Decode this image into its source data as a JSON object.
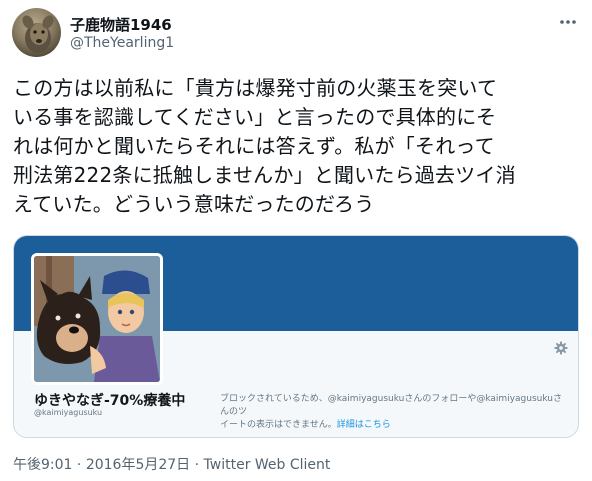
{
  "author": {
    "display_name": "子鹿物語1946",
    "handle": "@TheYearling1",
    "avatar_icon": "deer-avatar-icon",
    "more_icon": "more-dots-icon"
  },
  "tweet": {
    "text": "この方は以前私に「貴方は爆発寸前の火薬玉を突いて\nいる事を認識してください」と言ったので具体的にそ\nれは何かと聞いたらそれには答えず。私が「それって\n刑法第222条に抵触しませんか」と聞いたら過去ツイ消\nえていた。どういう意味だったのだろう"
  },
  "card": {
    "name": "ゆきやなぎ-70%療養中",
    "handle": "@kaimiyagusuku",
    "blocked_text_line1": "ブロックされているため、@kaimiyagusukuさんのフォローや@kaimiyagusukuさんのツ",
    "blocked_text_line2": "イートの表示はできません。",
    "details_link": "詳細はこちら",
    "banner_color": "#1b5e99",
    "gear_icon": "gear-icon"
  },
  "meta": {
    "time": "午後9:01",
    "separator": " · ",
    "date": "2016年5月27日",
    "separator2": " · ",
    "client": "Twitter Web Client"
  }
}
